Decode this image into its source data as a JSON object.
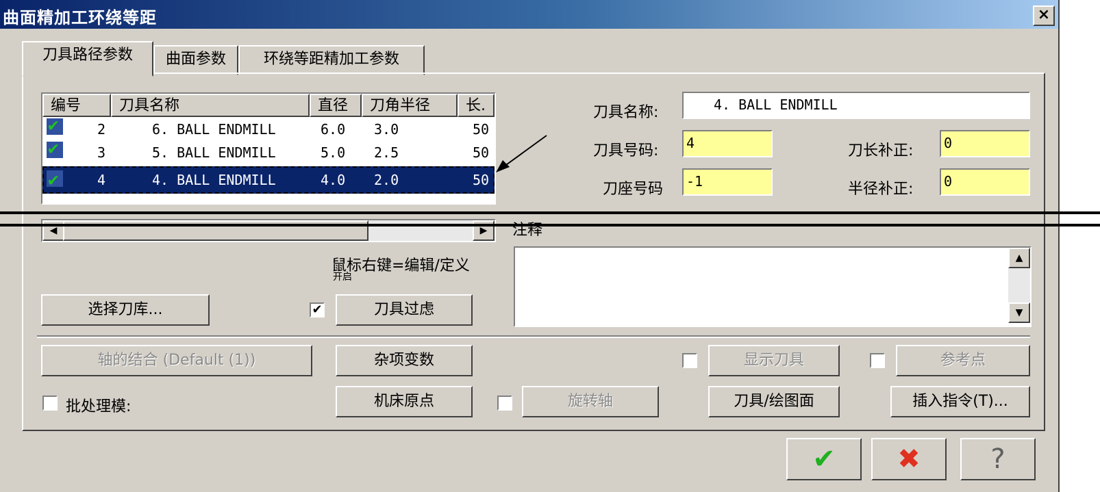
{
  "window": {
    "title": "曲面精加工环绕等距",
    "close_label": "×"
  },
  "tabs": [
    {
      "label": "刀具路径参数"
    },
    {
      "label": "曲面参数"
    },
    {
      "label": "环绕等距精加工参数"
    }
  ],
  "tool_list": {
    "headers": [
      "编号",
      "刀具名称",
      "直径",
      "刀角半径",
      "长."
    ],
    "rows": [
      {
        "num": "2",
        "name": "6. BALL ENDMILL",
        "dia": "6.0",
        "radius": "3.0",
        "len": "50"
      },
      {
        "num": "3",
        "name": "5. BALL ENDMILL",
        "dia": "5.0",
        "radius": "2.5",
        "len": "50"
      },
      {
        "num": "4",
        "name": "4. BALL ENDMILL",
        "dia": "4.0",
        "radius": "2.0",
        "len": "50"
      }
    ],
    "selected_index": 2
  },
  "hint": {
    "line1": "鼠标右键=编辑/定义",
    "line2": "开启"
  },
  "tool_props": {
    "name_label": "刀具名称:",
    "name_value": "4. BALL ENDMILL",
    "num_label": "刀具号码:",
    "num_value": "4",
    "holder_label": "刀座号码",
    "holder_value": "-1",
    "len_comp_label": "刀长补正:",
    "len_comp_value": "0",
    "rad_comp_label": "半径补正:",
    "rad_comp_value": "0",
    "notes_label": "注释"
  },
  "buttons": {
    "select_library": "选择刀库...",
    "tool_filter": "刀具过虑",
    "axis_combo": "轴的结合 (Default (1))",
    "misc_vars": "杂项变数",
    "show_tool": "显示刀具",
    "ref_point": "参考点",
    "batch_mode": "批处理模:",
    "machine_origin": "机床原点",
    "rotary_axis": "旋转轴",
    "tool_plane": "刀具/绘图面",
    "insert_cmd": "插入指令(T)..."
  },
  "dialog_buttons": {
    "ok": "✔",
    "cancel": "✖",
    "help": "?"
  },
  "colors": {
    "ok": "#20b020",
    "cancel": "#e03020",
    "field_yellow": "#ffff99",
    "selection": "#0a246a"
  }
}
